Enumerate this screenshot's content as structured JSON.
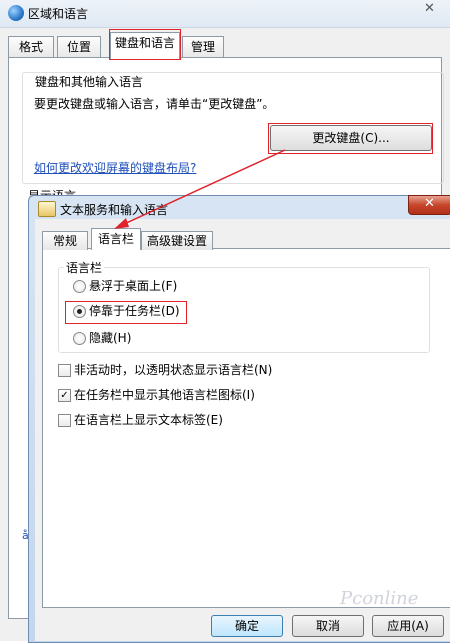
{
  "outer_window": {
    "title": "区域和语言",
    "close_glyph": "✕",
    "tabs": [
      "格式",
      "位置",
      "键盘和语言",
      "管理"
    ],
    "active_tab": "键盘和语言",
    "keyboard_group": {
      "label": "键盘和其他输入语言",
      "description": "要更改键盘或输入语言，请单击“更改键盘”。",
      "change_button": "更改键盘(C)...",
      "link": "如何更改欢迎屏幕的键盘布局?"
    },
    "display_language_label": "显示语言",
    "corner_glyph": "å"
  },
  "inner_dialog": {
    "title": "文本服务和输入语言",
    "close_glyph": "✕",
    "tabs": [
      "常规",
      "语言栏",
      "高级键设置"
    ],
    "active_tab": "语言栏",
    "language_bar_group": {
      "label": "语言栏",
      "options": [
        {
          "label": "悬浮于桌面上(F)",
          "selected": false
        },
        {
          "label": "停靠于任务栏(D)",
          "selected": true
        },
        {
          "label": "隐藏(H)",
          "selected": false
        }
      ]
    },
    "checkboxes": [
      {
        "label": "非活动时，以透明状态显示语言栏(N)",
        "checked": false,
        "mark": ""
      },
      {
        "label": "在任务栏中显示其他语言栏图标(I)",
        "checked": true,
        "mark": "✓"
      },
      {
        "label": "在语言栏上显示文本标签(E)",
        "checked": false,
        "mark": ""
      }
    ],
    "buttons": {
      "ok": "确定",
      "cancel": "取消",
      "apply": "应用(A)"
    }
  },
  "watermark": "Pconline",
  "colors": {
    "highlight": "#e0222a",
    "link": "#1f4fb8"
  }
}
